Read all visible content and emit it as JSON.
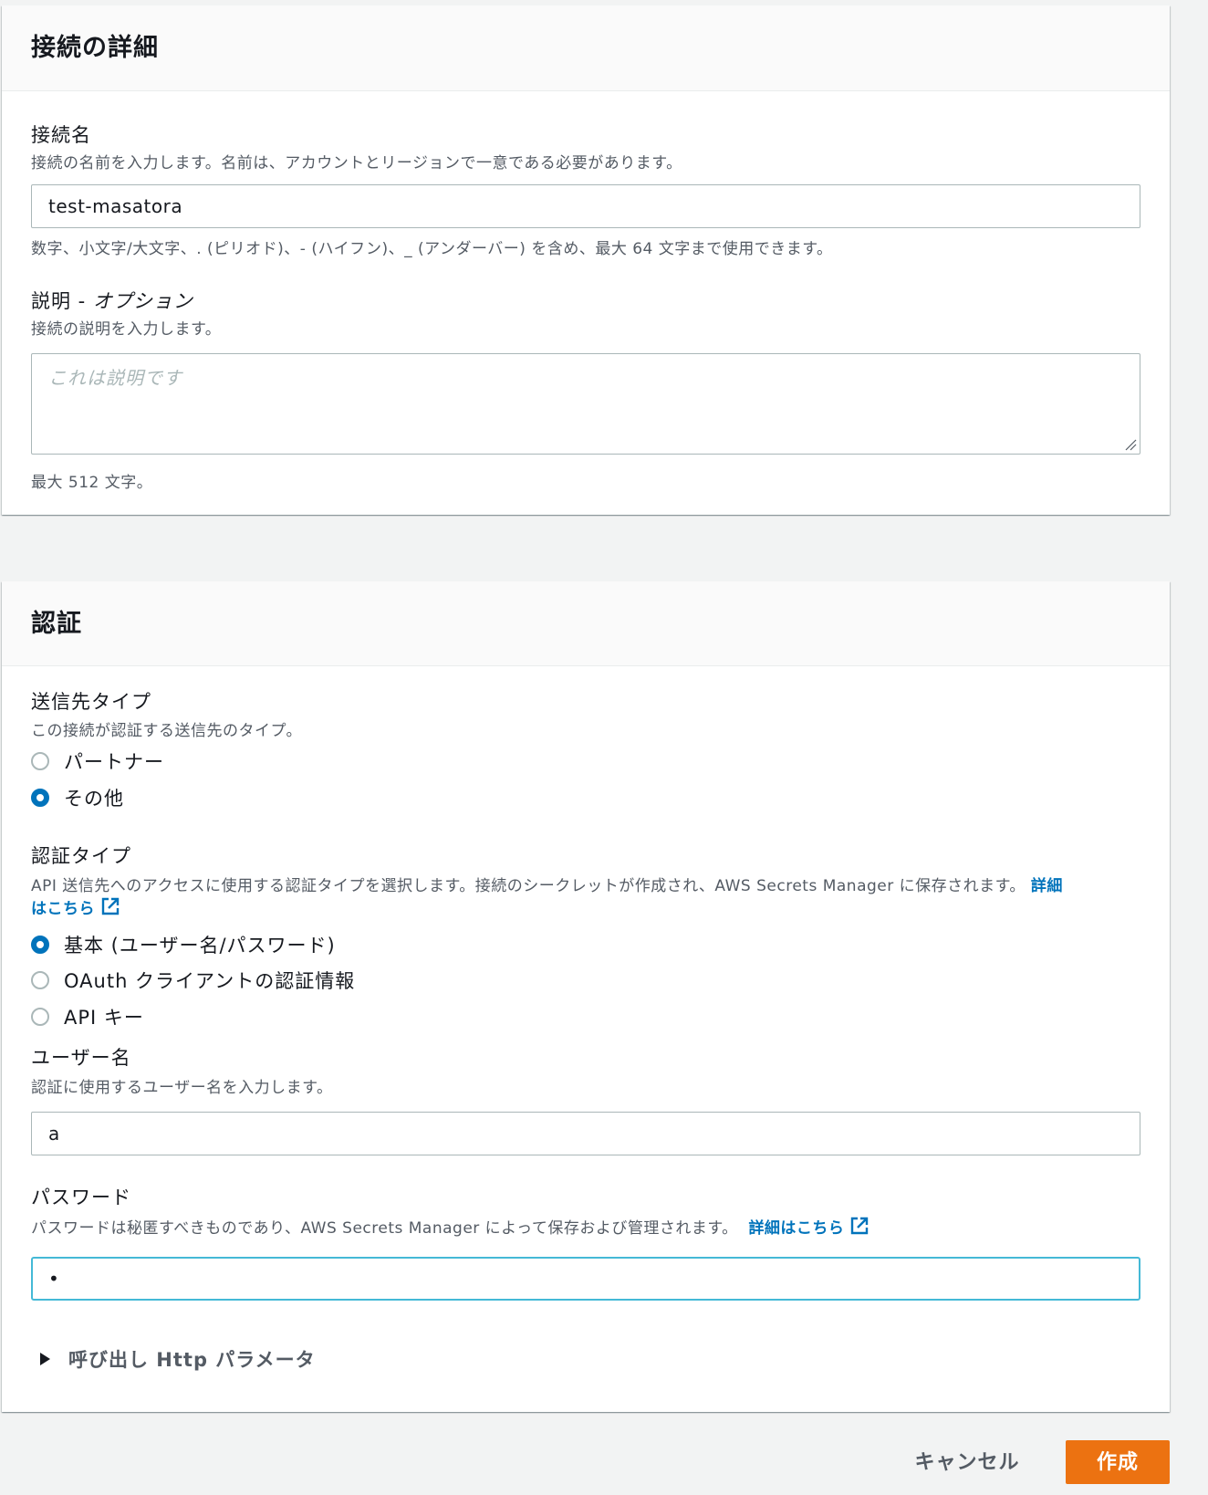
{
  "connection_details": {
    "title": "接続の詳細",
    "name_label": "接続名",
    "name_description": "接続の名前を入力します。名前は、アカウントとリージョンで一意である必要があります。",
    "name_value": "test-masatora",
    "name_constraint": "数字、小文字/大文字、. (ピリオド)、- (ハイフン)、_ (アンダーバー) を含め、最大 64 文字まで使用できます。",
    "description_label": "説明 - ",
    "description_label_optional": "オプション",
    "description_description": "接続の説明を入力します。",
    "description_placeholder": "これは説明です",
    "description_constraint": "最大 512 文字。"
  },
  "auth": {
    "title": "認証",
    "destination_type_label": "送信先タイプ",
    "destination_type_description": "この接続が認証する送信先のタイプ。",
    "destination_options": [
      {
        "label": "パートナー",
        "checked": false
      },
      {
        "label": "その他",
        "checked": true
      }
    ],
    "auth_type_label": "認証タイプ",
    "auth_type_description_line1": "API 送信先へのアクセスに使用する認証タイプを選択します。接続のシークレットが作成され、AWS Secrets Manager に保存されます。",
    "auth_type_link_part1": "詳細",
    "auth_type_link_part2": "はこちら",
    "auth_options": [
      {
        "label": "基本 (ユーザー名/パスワード)",
        "checked": true
      },
      {
        "label": "OAuth クライアントの認証情報",
        "checked": false
      },
      {
        "label": "API キー",
        "checked": false
      }
    ],
    "username_label": "ユーザー名",
    "username_description": "認証に使用するユーザー名を入力します。",
    "username_value": "a",
    "password_label": "パスワード",
    "password_description": "パスワードは秘匿すべきものであり、AWS Secrets Manager によって保存および管理されます。",
    "password_link": "詳細はこちら",
    "password_value": "•",
    "expander_label": "呼び出し Http パラメータ"
  },
  "actions": {
    "cancel_label": "キャンセル",
    "create_label": "作成"
  },
  "colors": {
    "accent": "#0073bb",
    "primary_button": "#ec7211",
    "focus_border": "#44b9d6"
  }
}
